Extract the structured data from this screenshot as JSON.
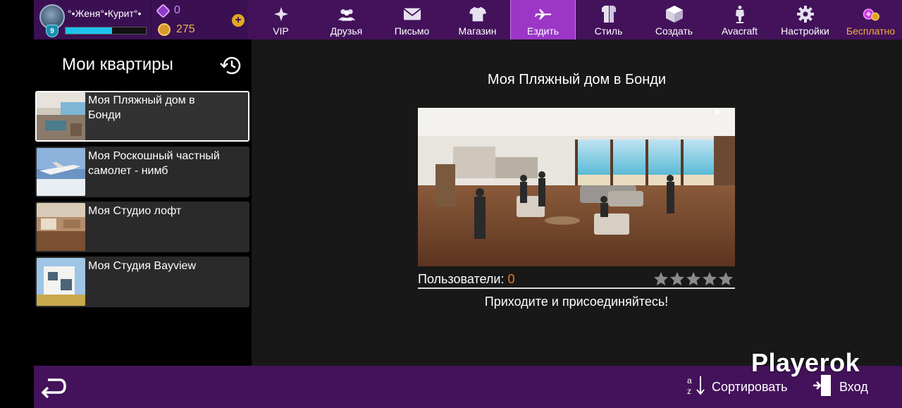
{
  "profile": {
    "username": "°•Женя°•Курит°•",
    "level": "9",
    "xp_progress": 0.58
  },
  "currency": {
    "gems": "0",
    "coins": "275",
    "add_icon": "plus-icon"
  },
  "nav": {
    "items": [
      {
        "label": "VIP",
        "icon": "sparkle-icon"
      },
      {
        "label": "Друзья",
        "icon": "friends-icon"
      },
      {
        "label": "Письмо",
        "icon": "mail-icon"
      },
      {
        "label": "Магазин",
        "icon": "shirt-icon"
      },
      {
        "label": "Ездить",
        "icon": "airplane-icon",
        "active": true
      },
      {
        "label": "Стиль",
        "icon": "style-icon"
      },
      {
        "label": "Создать",
        "icon": "box-icon"
      },
      {
        "label": "Avacraft",
        "icon": "mannequin-icon"
      },
      {
        "label": "Настройки",
        "icon": "gear-icon"
      },
      {
        "label": "Бесплатно",
        "icon": "free-gift-icon"
      }
    ]
  },
  "left_panel": {
    "title": "Мои квартиры",
    "history_icon": "history-icon",
    "apartments": [
      {
        "name": "Моя Пляжный дом в Бонди",
        "selected": true
      },
      {
        "name": "Моя Роскошный частный самолет - нимб",
        "selected": false
      },
      {
        "name": "Моя Студио лофт",
        "selected": false
      },
      {
        "name": "Моя Студия Bayview",
        "selected": false
      }
    ]
  },
  "detail": {
    "title": "Моя Пляжный дом в Бонди",
    "users_label": "Пользователи:",
    "users_count": "0",
    "rating": 0,
    "rating_max": 5,
    "join_text": "Приходите и присоединяйтесь!"
  },
  "bottom": {
    "back_icon": "back-arrow-icon",
    "sort_label": "Сортировать",
    "sort_icon": "sort-az-icon",
    "enter_label": "Вход",
    "enter_icon": "enter-door-icon"
  },
  "watermark": "Playerok",
  "colors": {
    "bar_purple": "#43125a",
    "active_tab": "#9b36c7",
    "accent_orange": "#f27a1c",
    "promo_gold": "#f1b23c",
    "xp_blue": "#1cc3ee"
  }
}
